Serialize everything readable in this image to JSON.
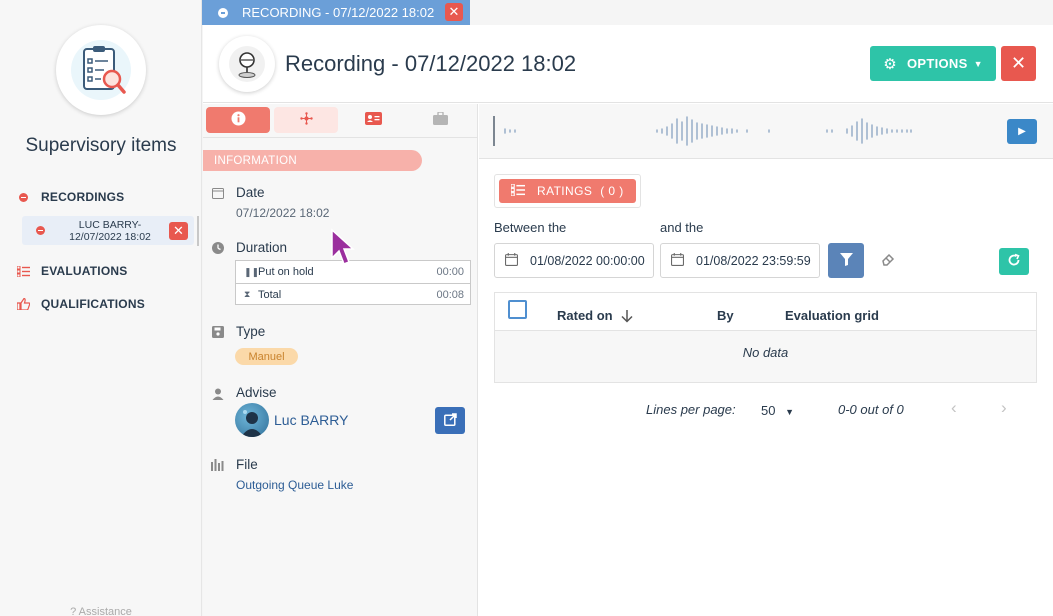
{
  "sidebar": {
    "title": "Supervisory items",
    "items": [
      {
        "label": "RECORDINGS",
        "icon": "record-icon"
      },
      {
        "label": "EVALUATIONS",
        "icon": "list-icon"
      },
      {
        "label": "QUALIFICATIONS",
        "icon": "thumbs-up-icon"
      }
    ],
    "sub_item": {
      "line1": "LUC BARRY-",
      "line2": "12/07/2022 18:02"
    },
    "assistance": "? Assistance"
  },
  "top_tab": {
    "label": "RECORDING - 07/12/2022 18:02"
  },
  "header": {
    "title": "Recording - 07/12/2022 18:02",
    "options_label": "OPTIONS"
  },
  "info": {
    "section": "INFORMATION",
    "date_label": "Date",
    "date_value": "07/12/2022 18:02",
    "duration_label": "Duration",
    "duration_rows": [
      {
        "label": "Put on hold",
        "value": "00:00"
      },
      {
        "label": "Total",
        "value": "00:08"
      }
    ],
    "type_label": "Type",
    "type_value": "Manuel",
    "advise_label": "Advise",
    "advisor_name": "Luc BARRY",
    "file_label": "File",
    "file_value": "Outgoing Queue Luke"
  },
  "ratings": {
    "button_label": "RATINGS",
    "count": "( 0 )",
    "between_label": "Between the",
    "and_label": "and the",
    "from_date": "01/08/2022 00:00:00",
    "to_date": "01/08/2022 23:59:59",
    "columns": {
      "rated_on": "Rated on",
      "by": "By",
      "grid": "Evaluation grid"
    },
    "no_data": "No data",
    "lines_per_page_label": "Lines per page:",
    "lines_per_page_value": "50",
    "range": "0-0 out of 0"
  },
  "colors": {
    "accent_red": "#e8584f",
    "accent_green": "#2ec4a8",
    "accent_blue": "#3a6fb8",
    "tab_blue": "#6b9fd8"
  }
}
